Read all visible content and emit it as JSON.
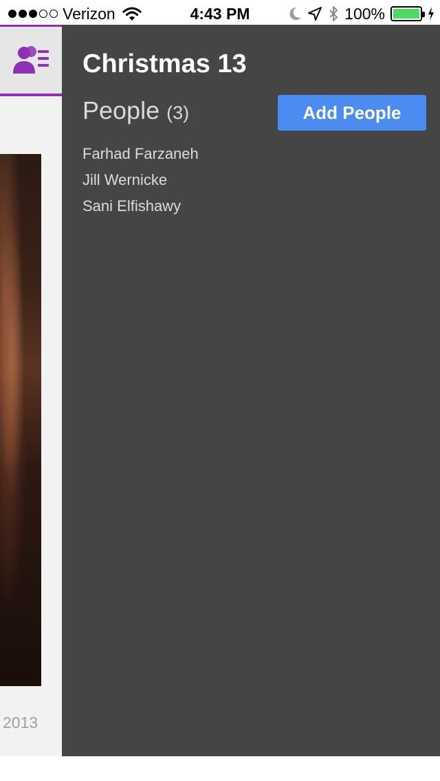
{
  "status_bar": {
    "carrier": "Verizon",
    "time": "4:43 PM",
    "battery_percent": "100%",
    "signal_bars_filled": 3,
    "signal_bars_total": 5,
    "icons": [
      "wifi-icon",
      "moon-icon",
      "location-icon",
      "bluetooth-icon",
      "battery-icon",
      "charging-icon"
    ]
  },
  "sidebar": {
    "tab_icon": "people-list-icon",
    "accent_color": "#8e2fb7"
  },
  "background": {
    "year": "2013"
  },
  "panel": {
    "album_title": "Christmas 13",
    "people_label": "People",
    "people_count": "(3)",
    "add_button_label": "Add People",
    "button_color": "#4a8cf0",
    "people": [
      {
        "name": "Farhad Farzaneh"
      },
      {
        "name": "Jill Wernicke"
      },
      {
        "name": "Sani Elfishawy"
      }
    ]
  }
}
